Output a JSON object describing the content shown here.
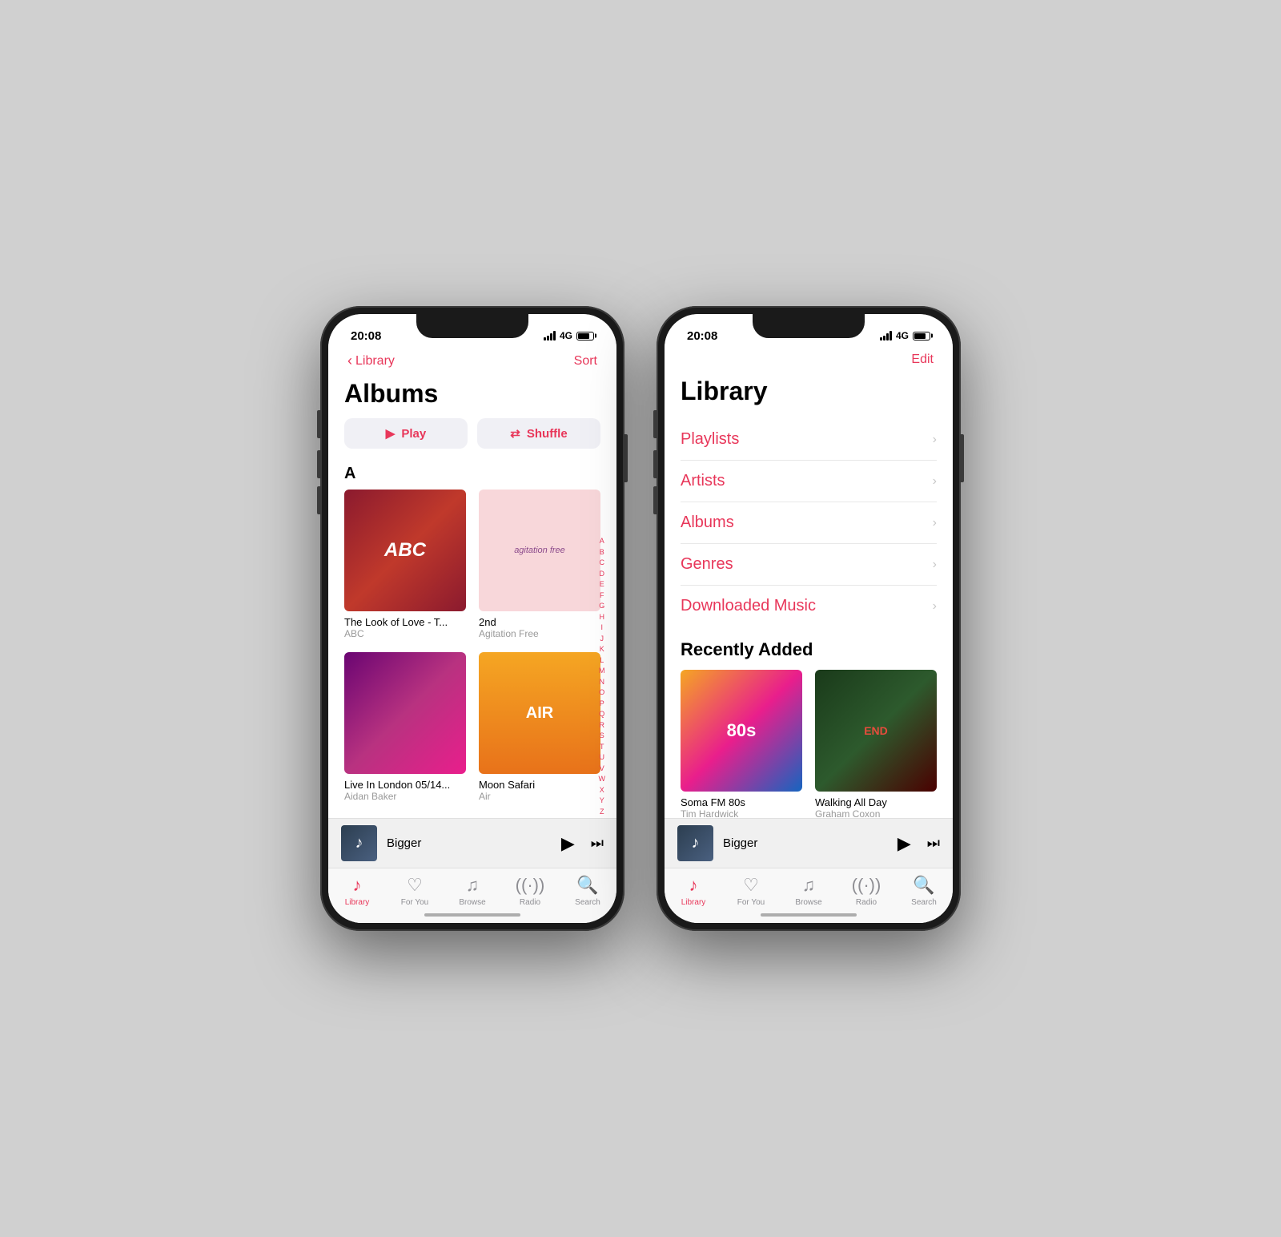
{
  "phone1": {
    "status": {
      "time": "20:08",
      "network": "4G"
    },
    "nav": {
      "back_label": "Library",
      "action_label": "Sort"
    },
    "page_title": "Albums",
    "play_button": "Play",
    "shuffle_button": "Shuffle",
    "section_a": "A",
    "albums": [
      {
        "title": "The Look of Love - T...",
        "artist": "ABC",
        "art": "abc"
      },
      {
        "title": "2nd",
        "artist": "Agitation Free",
        "art": "agitation"
      },
      {
        "title": "Live In London 05/14...",
        "artist": "Aidan Baker",
        "art": "live-london"
      },
      {
        "title": "Moon Safari",
        "artist": "Air",
        "art": "moon-safari"
      }
    ],
    "alphabet": [
      "A",
      "B",
      "C",
      "D",
      "E",
      "F",
      "G",
      "H",
      "I",
      "J",
      "K",
      "L",
      "M",
      "N",
      "O",
      "P",
      "Q",
      "R",
      "S",
      "T",
      "U",
      "V",
      "W",
      "X",
      "Y",
      "Z",
      "#",
      "?"
    ],
    "mini_player": {
      "track": "Bigger"
    },
    "tabs": [
      {
        "label": "Library",
        "icon": "library",
        "active": true
      },
      {
        "label": "For You",
        "icon": "heart",
        "active": false
      },
      {
        "label": "Browse",
        "icon": "note",
        "active": false
      },
      {
        "label": "Radio",
        "icon": "radio",
        "active": false
      },
      {
        "label": "Search",
        "icon": "search",
        "active": false
      }
    ]
  },
  "phone2": {
    "status": {
      "time": "20:08",
      "network": "4G"
    },
    "nav": {
      "action_label": "Edit"
    },
    "page_title": "Library",
    "library_items": [
      {
        "label": "Playlists"
      },
      {
        "label": "Artists"
      },
      {
        "label": "Albums"
      },
      {
        "label": "Genres"
      },
      {
        "label": "Downloaded Music"
      }
    ],
    "recently_added_header": "Recently Added",
    "recently_added": [
      {
        "title": "Soma FM 80s",
        "artist": "Tim Hardwick",
        "art": "soma"
      },
      {
        "title": "Walking All Day",
        "artist": "Graham Coxon",
        "art": "walking"
      }
    ],
    "mini_player": {
      "track": "Bigger"
    },
    "tabs": [
      {
        "label": "Library",
        "icon": "library",
        "active": true
      },
      {
        "label": "For You",
        "icon": "heart",
        "active": false
      },
      {
        "label": "Browse",
        "icon": "note",
        "active": false
      },
      {
        "label": "Radio",
        "icon": "radio",
        "active": false
      },
      {
        "label": "Search",
        "icon": "search",
        "active": false
      }
    ]
  }
}
